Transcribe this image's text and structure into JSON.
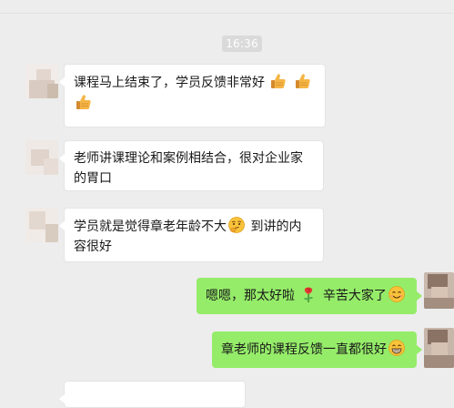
{
  "chat": {
    "timestamp": "16:36",
    "messages": [
      {
        "side": "left",
        "text_before": "课程马上结束了，学员反馈非常好",
        "emojis": [
          "thumbs-up",
          "thumbs-up",
          "thumbs-up"
        ]
      },
      {
        "side": "left",
        "text_before": "老师讲课理论和案例相结合，很对企业家的胃口"
      },
      {
        "side": "left",
        "text_before": "学员就是觉得章老年龄不大",
        "emoji": "thinking",
        "text_after": " 到讲的内容很好"
      },
      {
        "side": "right",
        "text_before": "嗯嗯，那太好啦",
        "emoji": "rose",
        "text_mid": "辛苦大家了",
        "emoji_end": "smile"
      },
      {
        "side": "right",
        "text_before": "章老师的课程反馈一直都很好",
        "emoji_end": "grin"
      }
    ]
  },
  "colors": {
    "background": "#ededed",
    "bubble_left": "#ffffff",
    "bubble_right": "#95ec69",
    "time_pill": "#dadada"
  }
}
